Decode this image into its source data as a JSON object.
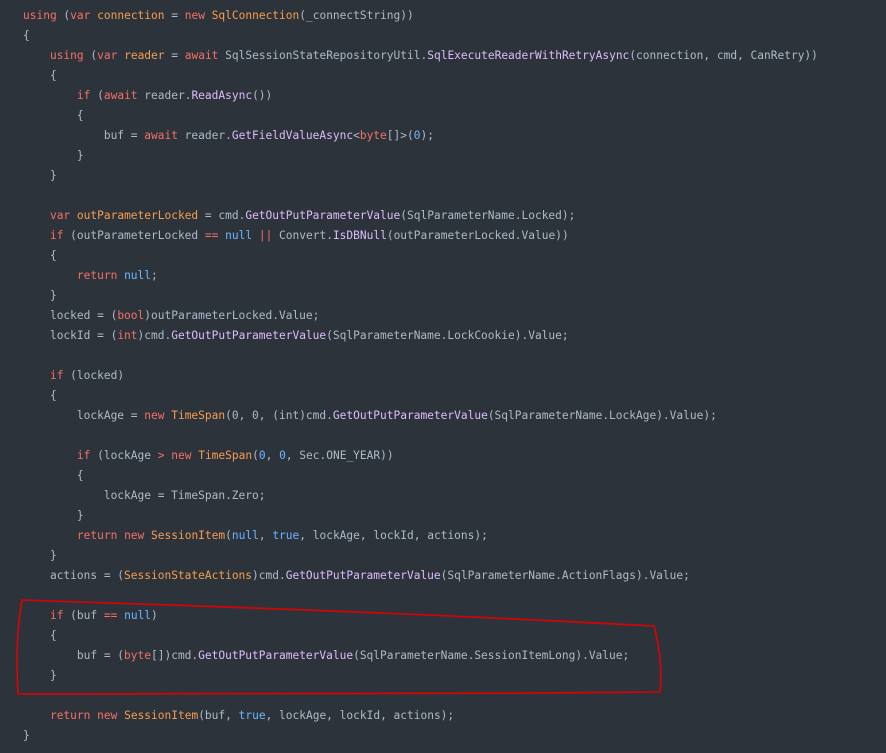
{
  "code": {
    "lines": [
      {
        "indent": 0,
        "tokens": [
          {
            "t": "kw",
            "v": "using"
          },
          {
            "t": "pl",
            "v": " ("
          },
          {
            "t": "kw",
            "v": "var"
          },
          {
            "t": "pl",
            "v": " "
          },
          {
            "t": "var",
            "v": "connection"
          },
          {
            "t": "pl",
            "v": " = "
          },
          {
            "t": "kw",
            "v": "new"
          },
          {
            "t": "pl",
            "v": " "
          },
          {
            "t": "type",
            "v": "SqlConnection"
          },
          {
            "t": "pl",
            "v": "(_connectString))"
          }
        ]
      },
      {
        "indent": 0,
        "tokens": [
          {
            "t": "pl",
            "v": "{"
          }
        ]
      },
      {
        "indent": 1,
        "tokens": [
          {
            "t": "kw",
            "v": "using"
          },
          {
            "t": "pl",
            "v": " ("
          },
          {
            "t": "kw",
            "v": "var"
          },
          {
            "t": "pl",
            "v": " "
          },
          {
            "t": "var",
            "v": "reader"
          },
          {
            "t": "pl",
            "v": " = "
          },
          {
            "t": "kw",
            "v": "await"
          },
          {
            "t": "pl",
            "v": " SqlSessionStateRepositoryUtil."
          },
          {
            "t": "fn",
            "v": "SqlExecuteReaderWithRetryAsync"
          },
          {
            "t": "pl",
            "v": "(connection, cmd, CanRetry))"
          }
        ]
      },
      {
        "indent": 1,
        "tokens": [
          {
            "t": "pl",
            "v": "{"
          }
        ]
      },
      {
        "indent": 2,
        "tokens": [
          {
            "t": "kw",
            "v": "if"
          },
          {
            "t": "pl",
            "v": " ("
          },
          {
            "t": "kw",
            "v": "await"
          },
          {
            "t": "pl",
            "v": " reader."
          },
          {
            "t": "fn",
            "v": "ReadAsync"
          },
          {
            "t": "pl",
            "v": "())"
          }
        ]
      },
      {
        "indent": 2,
        "tokens": [
          {
            "t": "pl",
            "v": "{"
          }
        ]
      },
      {
        "indent": 3,
        "tokens": [
          {
            "t": "pl",
            "v": "buf = "
          },
          {
            "t": "kw",
            "v": "await"
          },
          {
            "t": "pl",
            "v": " reader."
          },
          {
            "t": "fn",
            "v": "GetFieldValueAsync"
          },
          {
            "t": "pl",
            "v": "<"
          },
          {
            "t": "kw",
            "v": "byte"
          },
          {
            "t": "pl",
            "v": "[]>("
          },
          {
            "t": "lit",
            "v": "0"
          },
          {
            "t": "pl",
            "v": ");"
          }
        ]
      },
      {
        "indent": 2,
        "tokens": [
          {
            "t": "pl",
            "v": "}"
          }
        ]
      },
      {
        "indent": 1,
        "tokens": [
          {
            "t": "pl",
            "v": "}"
          }
        ]
      },
      {
        "indent": 0,
        "tokens": []
      },
      {
        "indent": 1,
        "tokens": [
          {
            "t": "kw",
            "v": "var"
          },
          {
            "t": "pl",
            "v": " "
          },
          {
            "t": "var",
            "v": "outParameterLocked"
          },
          {
            "t": "pl",
            "v": " = cmd."
          },
          {
            "t": "fn",
            "v": "GetOutPutParameterValue"
          },
          {
            "t": "pl",
            "v": "(SqlParameterName.Locked);"
          }
        ]
      },
      {
        "indent": 1,
        "tokens": [
          {
            "t": "kw",
            "v": "if"
          },
          {
            "t": "pl",
            "v": " (outParameterLocked "
          },
          {
            "t": "op",
            "v": "=="
          },
          {
            "t": "pl",
            "v": " "
          },
          {
            "t": "lit",
            "v": "null"
          },
          {
            "t": "pl",
            "v": " "
          },
          {
            "t": "op",
            "v": "||"
          },
          {
            "t": "pl",
            "v": " Convert."
          },
          {
            "t": "fn",
            "v": "IsDBNull"
          },
          {
            "t": "pl",
            "v": "(outParameterLocked.Value))"
          }
        ]
      },
      {
        "indent": 1,
        "tokens": [
          {
            "t": "pl",
            "v": "{"
          }
        ]
      },
      {
        "indent": 2,
        "tokens": [
          {
            "t": "kw",
            "v": "return"
          },
          {
            "t": "pl",
            "v": " "
          },
          {
            "t": "lit",
            "v": "null"
          },
          {
            "t": "pl",
            "v": ";"
          }
        ]
      },
      {
        "indent": 1,
        "tokens": [
          {
            "t": "pl",
            "v": "}"
          }
        ]
      },
      {
        "indent": 1,
        "tokens": [
          {
            "t": "pl",
            "v": "locked = ("
          },
          {
            "t": "kw",
            "v": "bool"
          },
          {
            "t": "pl",
            "v": ")outParameterLocked.Value;"
          }
        ]
      },
      {
        "indent": 1,
        "tokens": [
          {
            "t": "pl",
            "v": "lockId = ("
          },
          {
            "t": "kw",
            "v": "int"
          },
          {
            "t": "pl",
            "v": ")cmd."
          },
          {
            "t": "fn",
            "v": "GetOutPutParameterValue"
          },
          {
            "t": "pl",
            "v": "(SqlParameterName.LockCookie).Value;"
          }
        ]
      },
      {
        "indent": 0,
        "tokens": []
      },
      {
        "indent": 1,
        "tokens": [
          {
            "t": "kw",
            "v": "if"
          },
          {
            "t": "pl",
            "v": " (locked)"
          }
        ]
      },
      {
        "indent": 1,
        "tokens": [
          {
            "t": "pl",
            "v": "{"
          }
        ]
      },
      {
        "indent": 2,
        "tokens": [
          {
            "t": "pl",
            "v": "lockAge = "
          },
          {
            "t": "kw",
            "v": "new"
          },
          {
            "t": "pl",
            "v": " "
          },
          {
            "t": "type",
            "v": "TimeSpan"
          },
          {
            "t": "pl",
            "v": "(0, 0, (int)cmd."
          },
          {
            "t": "fn",
            "v": "GetOutPutParameterValue"
          },
          {
            "t": "pl",
            "v": "(SqlParameterName.LockAge).Value);"
          }
        ]
      },
      {
        "indent": 0,
        "tokens": []
      },
      {
        "indent": 2,
        "tokens": [
          {
            "t": "kw",
            "v": "if"
          },
          {
            "t": "pl",
            "v": " (lockAge "
          },
          {
            "t": "op",
            "v": ">"
          },
          {
            "t": "pl",
            "v": " "
          },
          {
            "t": "kw",
            "v": "new"
          },
          {
            "t": "pl",
            "v": " "
          },
          {
            "t": "type",
            "v": "TimeSpan"
          },
          {
            "t": "pl",
            "v": "("
          },
          {
            "t": "lit",
            "v": "0"
          },
          {
            "t": "pl",
            "v": ", "
          },
          {
            "t": "lit",
            "v": "0"
          },
          {
            "t": "pl",
            "v": ", Sec.ONE_YEAR))"
          }
        ]
      },
      {
        "indent": 2,
        "tokens": [
          {
            "t": "pl",
            "v": "{"
          }
        ]
      },
      {
        "indent": 3,
        "tokens": [
          {
            "t": "pl",
            "v": "lockAge = TimeSpan.Zero;"
          }
        ]
      },
      {
        "indent": 2,
        "tokens": [
          {
            "t": "pl",
            "v": "}"
          }
        ]
      },
      {
        "indent": 2,
        "tokens": [
          {
            "t": "kw",
            "v": "return"
          },
          {
            "t": "pl",
            "v": " "
          },
          {
            "t": "kw",
            "v": "new"
          },
          {
            "t": "pl",
            "v": " "
          },
          {
            "t": "type",
            "v": "SessionItem"
          },
          {
            "t": "pl",
            "v": "("
          },
          {
            "t": "lit",
            "v": "null"
          },
          {
            "t": "pl",
            "v": ", "
          },
          {
            "t": "lit",
            "v": "true"
          },
          {
            "t": "pl",
            "v": ", lockAge, lockId, actions);"
          }
        ]
      },
      {
        "indent": 1,
        "tokens": [
          {
            "t": "pl",
            "v": "}"
          }
        ]
      },
      {
        "indent": 1,
        "tokens": [
          {
            "t": "pl",
            "v": "actions = ("
          },
          {
            "t": "type",
            "v": "SessionStateActions"
          },
          {
            "t": "pl",
            "v": ")cmd."
          },
          {
            "t": "fn",
            "v": "GetOutPutParameterValue"
          },
          {
            "t": "pl",
            "v": "(SqlParameterName.ActionFlags).Value;"
          }
        ]
      },
      {
        "indent": 0,
        "tokens": []
      },
      {
        "indent": 1,
        "tokens": [
          {
            "t": "kw",
            "v": "if"
          },
          {
            "t": "pl",
            "v": " (buf "
          },
          {
            "t": "op",
            "v": "=="
          },
          {
            "t": "pl",
            "v": " "
          },
          {
            "t": "lit",
            "v": "null"
          },
          {
            "t": "pl",
            "v": ")"
          }
        ]
      },
      {
        "indent": 1,
        "tokens": [
          {
            "t": "pl",
            "v": "{"
          }
        ]
      },
      {
        "indent": 2,
        "tokens": [
          {
            "t": "pl",
            "v": "buf = ("
          },
          {
            "t": "kw",
            "v": "byte"
          },
          {
            "t": "pl",
            "v": "[])cmd."
          },
          {
            "t": "fn",
            "v": "GetOutPutParameterValue"
          },
          {
            "t": "pl",
            "v": "(SqlParameterName.SessionItemLong).Value;"
          }
        ]
      },
      {
        "indent": 1,
        "tokens": [
          {
            "t": "pl",
            "v": "}"
          }
        ]
      },
      {
        "indent": 0,
        "tokens": []
      },
      {
        "indent": 1,
        "tokens": [
          {
            "t": "kw",
            "v": "return"
          },
          {
            "t": "pl",
            "v": " "
          },
          {
            "t": "kw",
            "v": "new"
          },
          {
            "t": "pl",
            "v": " "
          },
          {
            "t": "type",
            "v": "SessionItem"
          },
          {
            "t": "pl",
            "v": "(buf, "
          },
          {
            "t": "lit",
            "v": "true"
          },
          {
            "t": "pl",
            "v": ", lockAge, lockId, actions);"
          }
        ]
      },
      {
        "indent": 0,
        "tokens": [
          {
            "t": "pl",
            "v": "}"
          }
        ]
      }
    ]
  },
  "annotation": {
    "color": "#e00000"
  },
  "colors": {
    "background": "#2d333b",
    "keyword": "#f47067",
    "type": "#f69d50",
    "function": "#dcbdfb",
    "literal": "#6cb6ff",
    "plain": "#adbac7"
  }
}
